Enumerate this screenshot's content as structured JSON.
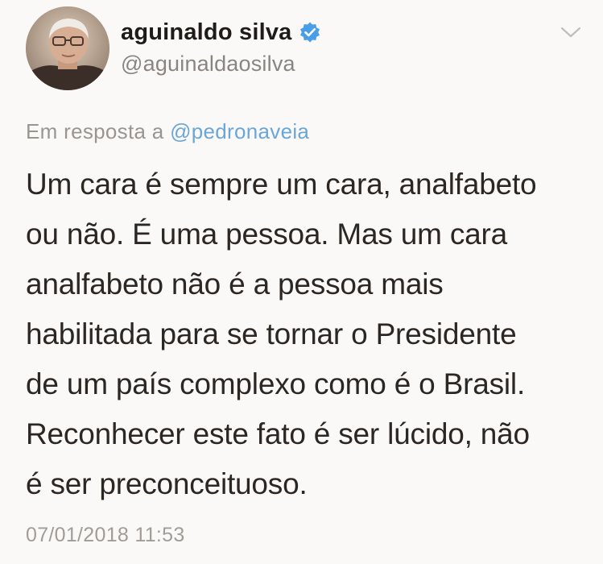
{
  "author": {
    "display_name": "aguinaldo silva",
    "handle": "@aguinaldaosilva",
    "verified": true,
    "avatar": "profile-photo"
  },
  "reply": {
    "prefix": "Em resposta a",
    "mention": "@pedronaveia"
  },
  "tweet": {
    "lines": [
      "Um cara é sempre um cara, analfabeto",
      "ou não. É uma pessoa. Mas um cara",
      "analfabeto não é a pessoa mais",
      "habilitada para se tornar o Presidente",
      "de um país complexo como é o Brasil.",
      "Reconhecer este fato é ser lúcido, não",
      "é ser preconceituoso."
    ],
    "timestamp": "07/01/2018 11:53"
  },
  "icons": {
    "verified": "verified-badge-icon",
    "menu": "chevron-down-icon"
  },
  "colors": {
    "background": "#fbf9f7",
    "mention": "#6aa6d8",
    "verified": "#4a9ee8",
    "muted_text": "#9a9591",
    "body_text": "#2d2724"
  }
}
